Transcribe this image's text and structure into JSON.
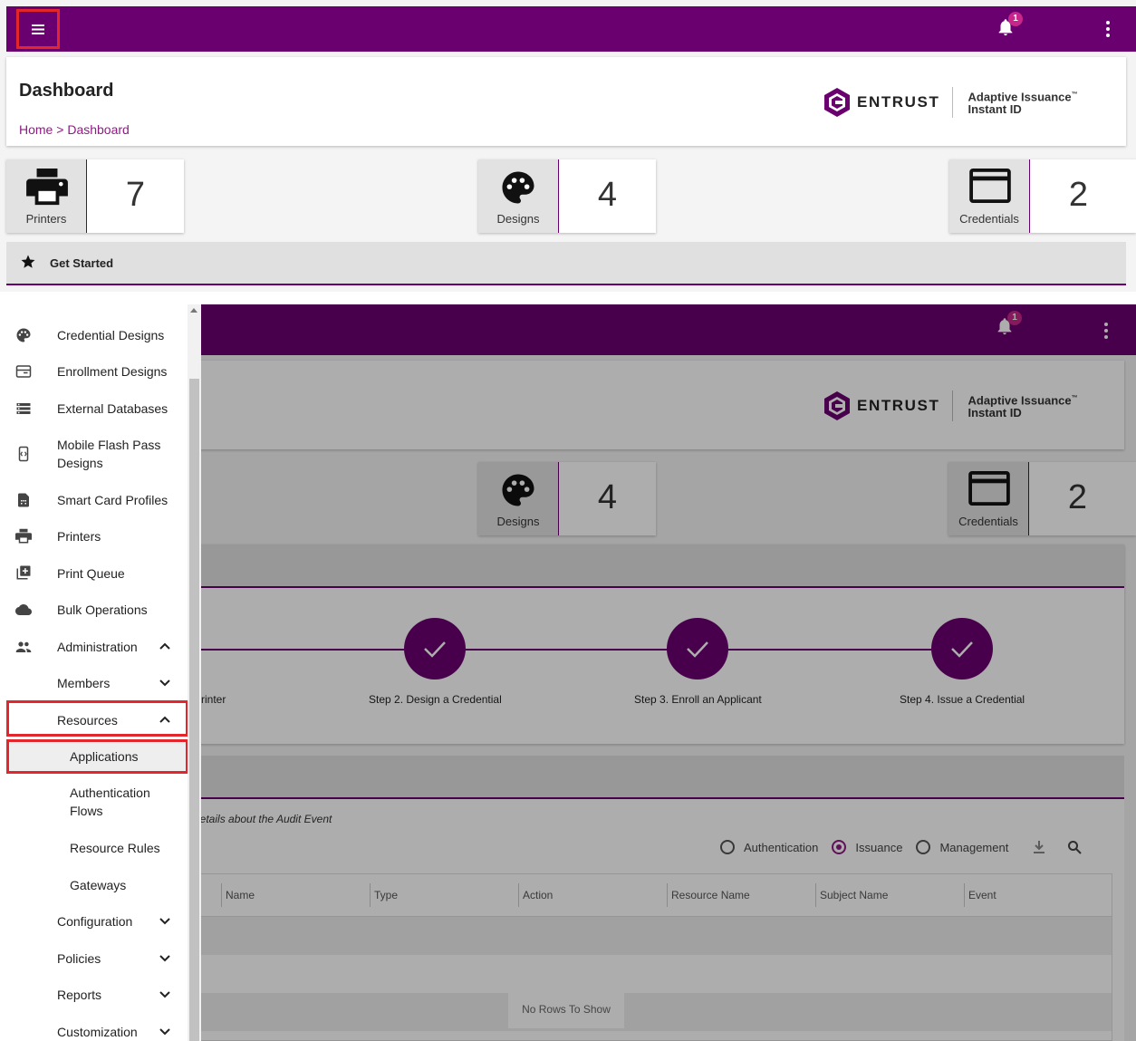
{
  "notifications": {
    "count": "1"
  },
  "header": {
    "title": "Dashboard",
    "breadcrumb": {
      "home": "Home",
      "sep": " > ",
      "current": "Dashboard"
    },
    "logo": {
      "wordmark": "ENTRUST",
      "product_line1": "Adaptive Issuance",
      "tm": "™",
      "product_line2": "Instant ID"
    }
  },
  "stats": [
    {
      "label": "Printers",
      "value": "7",
      "icon": "printer-icon"
    },
    {
      "label": "Designs",
      "value": "4",
      "icon": "palette-icon"
    },
    {
      "label": "Credentials",
      "value": "2",
      "icon": "credit-card-icon"
    }
  ],
  "get_started": {
    "label": "Get Started"
  },
  "steps": [
    {
      "label": "rinter"
    },
    {
      "label": "Step 2. Design a Credential"
    },
    {
      "label": "Step 3. Enroll an Applicant"
    },
    {
      "label": "Step 4. Issue a Credential"
    }
  ],
  "audit": {
    "hint": "details about the Audit Event",
    "filters": [
      {
        "label": "Authentication",
        "selected": false
      },
      {
        "label": "Issuance",
        "selected": true
      },
      {
        "label": "Management",
        "selected": false
      }
    ],
    "columns": [
      "Name",
      "Type",
      "Action",
      "Resource Name",
      "Subject Name",
      "Event"
    ],
    "empty_message": "No Rows To Show"
  },
  "sidebar": {
    "items": [
      {
        "label": "Credential Designs",
        "icon": "palette-icon"
      },
      {
        "label": "Enrollment Designs",
        "icon": "form-icon"
      },
      {
        "label": "External Databases",
        "icon": "storage-icon"
      },
      {
        "label": "Mobile Flash Pass",
        "label2": "Designs",
        "icon": "mobile-code-icon"
      },
      {
        "label": "Smart Card Profiles",
        "icon": "sim-card-icon"
      },
      {
        "label": "Printers",
        "icon": "printer-icon"
      },
      {
        "label": "Print Queue",
        "icon": "queue-add-icon"
      },
      {
        "label": "Bulk Operations",
        "icon": "cloud-icon"
      },
      {
        "label": "Administration",
        "icon": "people-icon"
      },
      {
        "label": "Members"
      },
      {
        "label": "Resources"
      },
      {
        "label": "Applications"
      },
      {
        "label": "Authentication",
        "label2": "Flows"
      },
      {
        "label": "Resource Rules"
      },
      {
        "label": "Gateways"
      },
      {
        "label": "Configuration"
      },
      {
        "label": "Policies"
      },
      {
        "label": "Reports"
      },
      {
        "label": "Customization"
      }
    ]
  },
  "colors": {
    "brand": "#6a0070",
    "accent": "#8e1a83",
    "highlight": "#e3252c",
    "badge": "#c7268a"
  }
}
